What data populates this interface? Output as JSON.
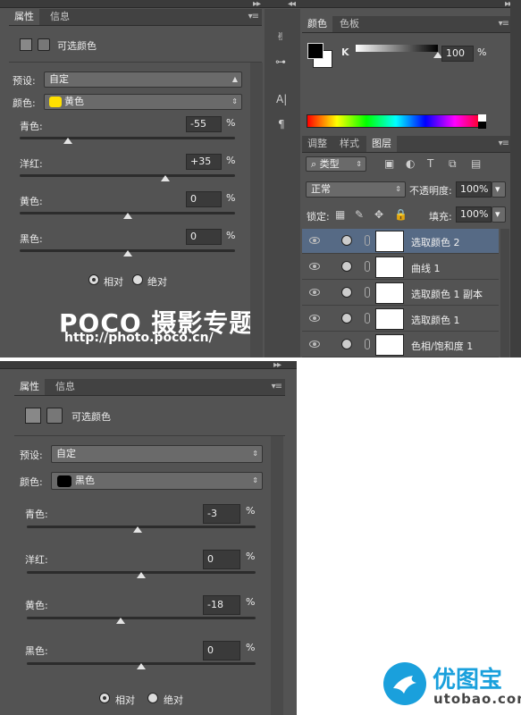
{
  "top": {
    "properties": {
      "tabs": [
        "属性",
        "信息"
      ],
      "panel_title": "可选颜色",
      "preset_label": "预设:",
      "preset_value": "自定",
      "color_label": "颜色:",
      "color_value": "黄色",
      "color_swatch": "#ffe000",
      "sliders": [
        {
          "label": "青色:",
          "value": "-55",
          "unit": "%",
          "level": -55
        },
        {
          "label": "洋红:",
          "value": "+35",
          "unit": "%",
          "level": 35
        },
        {
          "label": "黄色:",
          "value": "0",
          "unit": "%",
          "level": 0
        },
        {
          "label": "黑色:",
          "value": "0",
          "unit": "%",
          "level": 0
        }
      ],
      "radio_relative": "相对",
      "radio_absolute": "绝对"
    },
    "watermark": {
      "brand": "POCO 摄影专题",
      "url": "http://photo.poco.cn/"
    },
    "color_panel": {
      "tabs": [
        "颜色",
        "色板"
      ],
      "channel": "K",
      "value": "100",
      "unit": "%",
      "level": 100
    },
    "layers_panel": {
      "tabs": [
        "调整",
        "样式",
        "图层"
      ],
      "filter_label": "类型",
      "blend_mode": "正常",
      "opacity_label": "不透明度:",
      "opacity_value": "100%",
      "lock_label": "锁定:",
      "fill_label": "填充:",
      "fill_value": "100%",
      "layers": [
        {
          "name": "选取颜色 2",
          "selected": true
        },
        {
          "name": "曲线 1",
          "selected": false
        },
        {
          "name": "选取颜色 1 副本",
          "selected": false
        },
        {
          "name": "选取颜色 1",
          "selected": false
        },
        {
          "name": "色相/饱和度 1",
          "selected": false
        }
      ]
    }
  },
  "bottom": {
    "properties": {
      "tabs": [
        "属性",
        "信息"
      ],
      "panel_title": "可选颜色",
      "preset_label": "预设:",
      "preset_value": "自定",
      "color_label": "颜色:",
      "color_value": "黑色",
      "color_swatch": "#000000",
      "sliders": [
        {
          "label": "青色:",
          "value": "-3",
          "unit": "%",
          "level": -3
        },
        {
          "label": "洋红:",
          "value": "0",
          "unit": "%",
          "level": 0
        },
        {
          "label": "黄色:",
          "value": "-18",
          "unit": "%",
          "level": -18
        },
        {
          "label": "黑色:",
          "value": "0",
          "unit": "%",
          "level": 0
        }
      ],
      "radio_relative": "相对",
      "radio_absolute": "绝对"
    }
  },
  "logo": {
    "name": "优图宝",
    "url": "utobao.com",
    "color": "#1aa0dc"
  }
}
